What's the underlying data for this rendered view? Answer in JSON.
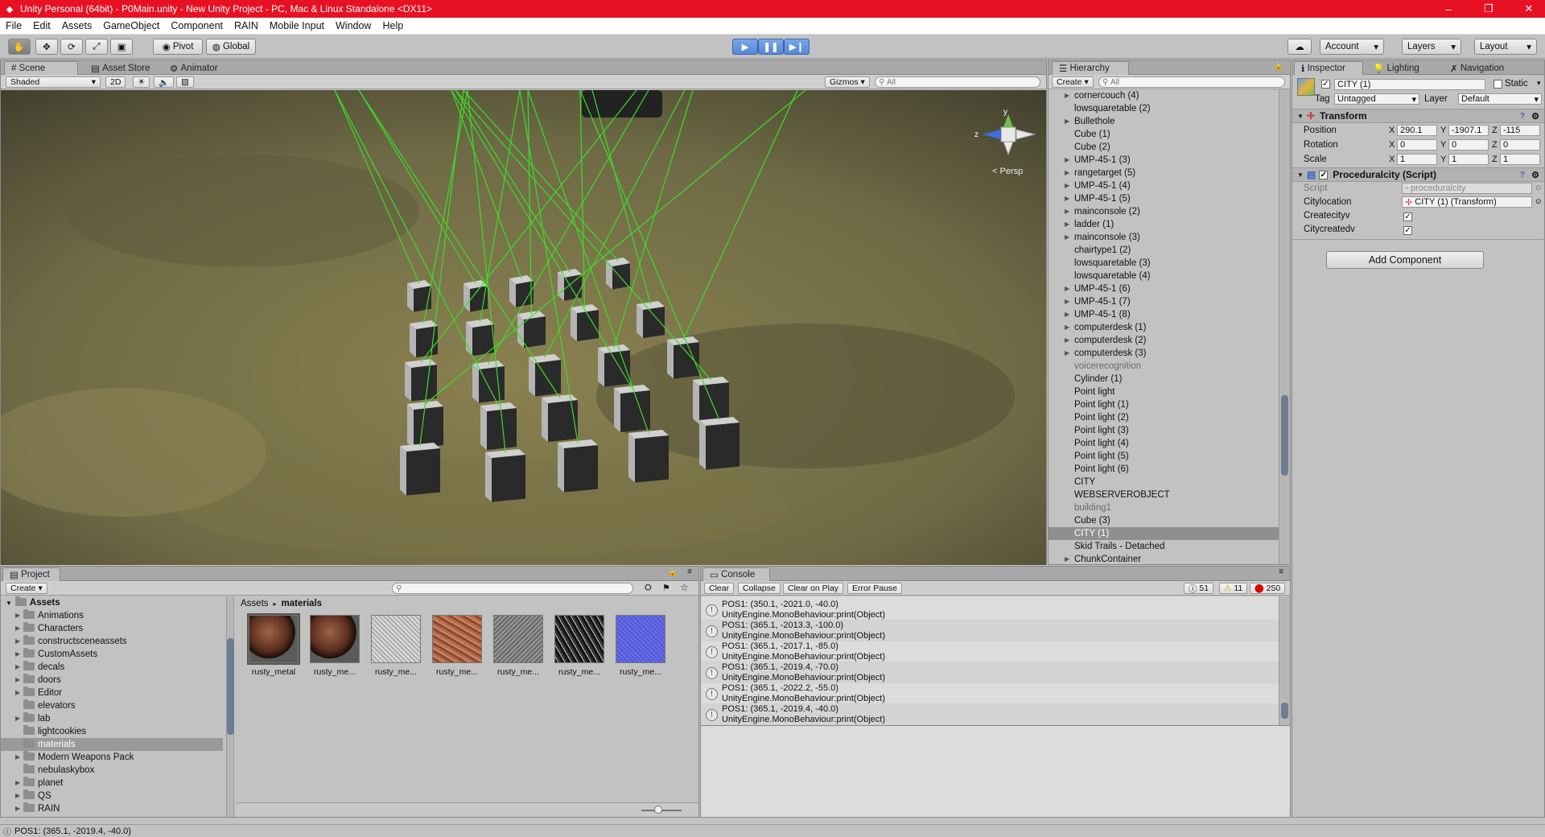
{
  "window": {
    "title": "Unity Personal (64bit) - P0Main.unity - New Unity Project - PC, Mac & Linux Standalone <DX11>",
    "controls": {
      "minimize": "–",
      "maximize": "❐",
      "close": "✕"
    }
  },
  "menu": [
    "File",
    "Edit",
    "Assets",
    "GameObject",
    "Component",
    "RAIN",
    "Mobile Input",
    "Window",
    "Help"
  ],
  "toolbar": {
    "pivot_label": "Pivot",
    "global_label": "Global",
    "account_label": "Account",
    "layers_label": "Layers",
    "layout_label": "Layout"
  },
  "scene": {
    "tabs": [
      "Scene",
      "Asset Store",
      "Animator"
    ],
    "shading_mode": "Shaded",
    "mode_2d": "2D",
    "gizmos_label": "Gizmos",
    "search_placeholder": "All",
    "projection_label": "Persp",
    "axis_labels": {
      "y": "y",
      "z": "z"
    }
  },
  "hierarchy": {
    "tab": "Hierarchy",
    "create_label": "Create",
    "search_placeholder": "All",
    "items": [
      {
        "name": "cornercouch (4)",
        "expandable": true,
        "state": "normal"
      },
      {
        "name": "lowsquaretable (2)",
        "expandable": false,
        "state": "normal"
      },
      {
        "name": "Bullethole",
        "expandable": true,
        "state": "normal"
      },
      {
        "name": "Cube (1)",
        "expandable": false,
        "state": "normal"
      },
      {
        "name": "Cube (2)",
        "expandable": false,
        "state": "normal"
      },
      {
        "name": "UMP-45-1 (3)",
        "expandable": true,
        "state": "normal"
      },
      {
        "name": "rangetarget (5)",
        "expandable": true,
        "state": "normal"
      },
      {
        "name": "UMP-45-1 (4)",
        "expandable": true,
        "state": "normal"
      },
      {
        "name": "UMP-45-1 (5)",
        "expandable": true,
        "state": "normal"
      },
      {
        "name": "mainconsole (2)",
        "expandable": true,
        "state": "normal"
      },
      {
        "name": "ladder (1)",
        "expandable": true,
        "state": "normal"
      },
      {
        "name": "mainconsole (3)",
        "expandable": true,
        "state": "normal"
      },
      {
        "name": "chairtype1 (2)",
        "expandable": false,
        "state": "normal"
      },
      {
        "name": "lowsquaretable (3)",
        "expandable": false,
        "state": "normal"
      },
      {
        "name": "lowsquaretable (4)",
        "expandable": false,
        "state": "normal"
      },
      {
        "name": "UMP-45-1 (6)",
        "expandable": true,
        "state": "normal"
      },
      {
        "name": "UMP-45-1 (7)",
        "expandable": true,
        "state": "normal"
      },
      {
        "name": "UMP-45-1 (8)",
        "expandable": true,
        "state": "normal"
      },
      {
        "name": "computerdesk (1)",
        "expandable": true,
        "state": "normal"
      },
      {
        "name": "computerdesk (2)",
        "expandable": true,
        "state": "normal"
      },
      {
        "name": "computerdesk (3)",
        "expandable": true,
        "state": "normal"
      },
      {
        "name": "voicerecognition",
        "expandable": false,
        "state": "dim"
      },
      {
        "name": "Cylinder (1)",
        "expandable": false,
        "state": "normal"
      },
      {
        "name": "Point light",
        "expandable": false,
        "state": "normal"
      },
      {
        "name": "Point light (1)",
        "expandable": false,
        "state": "normal"
      },
      {
        "name": "Point light (2)",
        "expandable": false,
        "state": "normal"
      },
      {
        "name": "Point light (3)",
        "expandable": false,
        "state": "normal"
      },
      {
        "name": "Point light (4)",
        "expandable": false,
        "state": "normal"
      },
      {
        "name": "Point light (5)",
        "expandable": false,
        "state": "normal"
      },
      {
        "name": "Point light (6)",
        "expandable": false,
        "state": "normal"
      },
      {
        "name": "CITY",
        "expandable": false,
        "state": "normal"
      },
      {
        "name": "WEBSERVEROBJECT",
        "expandable": false,
        "state": "normal"
      },
      {
        "name": "building1",
        "expandable": false,
        "state": "dim"
      },
      {
        "name": "Cube (3)",
        "expandable": false,
        "state": "normal"
      },
      {
        "name": "CITY (1)",
        "expandable": false,
        "state": "selected"
      },
      {
        "name": "Skid Trails - Detached",
        "expandable": false,
        "state": "normal"
      },
      {
        "name": "ChunkContainer",
        "expandable": true,
        "state": "normal"
      }
    ]
  },
  "inspector": {
    "tabs": [
      "Inspector",
      "Lighting",
      "Navigation"
    ],
    "object_name": "CITY (1)",
    "static_label": "Static",
    "tag_label": "Tag",
    "tag_value": "Untagged",
    "layer_label": "Layer",
    "layer_value": "Default",
    "transform": {
      "title": "Transform",
      "rows": [
        {
          "label": "Position",
          "x": "290.1",
          "y": "-1907.1",
          "z": "-115"
        },
        {
          "label": "Rotation",
          "x": "0",
          "y": "0",
          "z": "0"
        },
        {
          "label": "Scale",
          "x": "1",
          "y": "1",
          "z": "1"
        }
      ]
    },
    "script": {
      "title": "Proceduralcity (Script)",
      "script_label": "Script",
      "script_value": "proceduralcity",
      "citylocation_label": "Citylocation",
      "citylocation_value": "CITY (1) (Transform)",
      "createcityv_label": "Createcityv",
      "citycreatedv_label": "Citycreatedv"
    },
    "add_component_label": "Add Component"
  },
  "project": {
    "tab": "Project",
    "create_label": "Create",
    "root_label": "Assets",
    "folders": [
      {
        "name": "Animations",
        "expandable": true,
        "selected": false
      },
      {
        "name": "Characters",
        "expandable": true,
        "selected": false
      },
      {
        "name": "constructsceneassets",
        "expandable": true,
        "selected": false
      },
      {
        "name": "CustomAssets",
        "expandable": true,
        "selected": false
      },
      {
        "name": "decals",
        "expandable": true,
        "selected": false
      },
      {
        "name": "doors",
        "expandable": true,
        "selected": false
      },
      {
        "name": "Editor",
        "expandable": true,
        "selected": false
      },
      {
        "name": "elevators",
        "expandable": false,
        "selected": false
      },
      {
        "name": "lab",
        "expandable": true,
        "selected": false
      },
      {
        "name": "lightcookies",
        "expandable": false,
        "selected": false
      },
      {
        "name": "materials",
        "expandable": false,
        "selected": true
      },
      {
        "name": "Modern Weapons Pack",
        "expandable": true,
        "selected": false
      },
      {
        "name": "nebulaskybox",
        "expandable": false,
        "selected": false
      },
      {
        "name": "planet",
        "expandable": true,
        "selected": false
      },
      {
        "name": "QS",
        "expandable": true,
        "selected": false
      },
      {
        "name": "RAIN",
        "expandable": true,
        "selected": false
      }
    ],
    "breadcrumb": [
      "Assets",
      "materials"
    ],
    "assets": [
      {
        "label": "rusty_metal",
        "thumb": "sphere"
      },
      {
        "label": "rusty_me...",
        "thumb": "sphere"
      },
      {
        "label": "rusty_me...",
        "thumb": "noise-light"
      },
      {
        "label": "rusty_me...",
        "thumb": "rust"
      },
      {
        "label": "rusty_me...",
        "thumb": "noise-grey"
      },
      {
        "label": "rusty_me...",
        "thumb": "noise-dark"
      },
      {
        "label": "rusty_me...",
        "thumb": "blue"
      }
    ]
  },
  "console": {
    "tab": "Console",
    "buttons": [
      "Clear",
      "Collapse",
      "Clear on Play",
      "Error Pause"
    ],
    "counts": {
      "messages": "51",
      "warnings": "11",
      "errors": "250"
    },
    "entries": [
      {
        "line1": "POS1: (350.1, -2021.0, -40.0)",
        "line2": "UnityEngine.MonoBehaviour:print(Object)"
      },
      {
        "line1": "POS1: (365.1, -2013.3, -100.0)",
        "line2": "UnityEngine.MonoBehaviour:print(Object)"
      },
      {
        "line1": "POS1: (365.1, -2017.1, -85.0)",
        "line2": "UnityEngine.MonoBehaviour:print(Object)"
      },
      {
        "line1": "POS1: (365.1, -2019.4, -70.0)",
        "line2": "UnityEngine.MonoBehaviour:print(Object)"
      },
      {
        "line1": "POS1: (365.1, -2022.2, -55.0)",
        "line2": "UnityEngine.MonoBehaviour:print(Object)"
      },
      {
        "line1": "POS1: (365.1, -2019.4, -40.0)",
        "line2": "UnityEngine.MonoBehaviour:print(Object)"
      }
    ]
  },
  "status": {
    "text": "POS1: (365.1, -2019.4, -40.0)"
  },
  "colors": {
    "title_bar": "#e81123",
    "play_active": "#5887d6",
    "gizmo_lines": "#3ddc2a",
    "selection": "#8f8f8f"
  }
}
